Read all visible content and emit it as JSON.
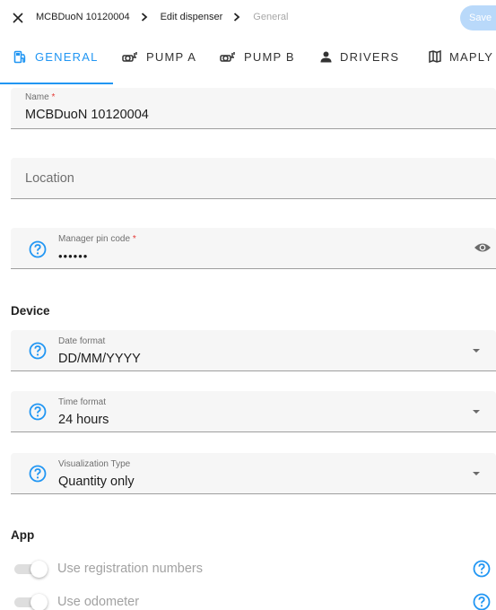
{
  "header": {
    "close_icon": "close-icon",
    "breadcrumbs": [
      "MCBDuoN 10120004",
      "Edit dispenser",
      "General"
    ],
    "save_label": "Save"
  },
  "tabs": [
    {
      "label": "GENERAL",
      "icon": "gas-station-icon",
      "active": true
    },
    {
      "label": "PUMP A",
      "icon": "pump-icon",
      "active": false
    },
    {
      "label": "PUMP B",
      "icon": "pump-icon",
      "active": false
    },
    {
      "label": "DRIVERS",
      "icon": "person-icon",
      "active": false
    },
    {
      "label": "MAPLY",
      "icon": "map-icon",
      "active": false
    }
  ],
  "form": {
    "name": {
      "label": "Name",
      "required": "*",
      "value": "MCBDuoN 10120004"
    },
    "location": {
      "placeholder": "Location",
      "value": ""
    },
    "pin": {
      "label": "Manager pin code",
      "required": "*",
      "value": "••••••"
    }
  },
  "device": {
    "title": "Device",
    "date_format": {
      "label": "Date format",
      "value": "DD/MM/YYYY"
    },
    "time_format": {
      "label": "Time format",
      "value": "24 hours"
    },
    "visualization_type": {
      "label": "Visualization Type",
      "value": "Quantity only"
    }
  },
  "app": {
    "title": "App",
    "toggles": [
      {
        "label": "Use registration numbers",
        "on": false
      },
      {
        "label": "Use odometer",
        "on": false
      }
    ]
  },
  "colors": {
    "accent": "#2196f3",
    "save_button": "#b9d9fa",
    "field_bg": "#f6f6f6",
    "required": "#e53935"
  }
}
